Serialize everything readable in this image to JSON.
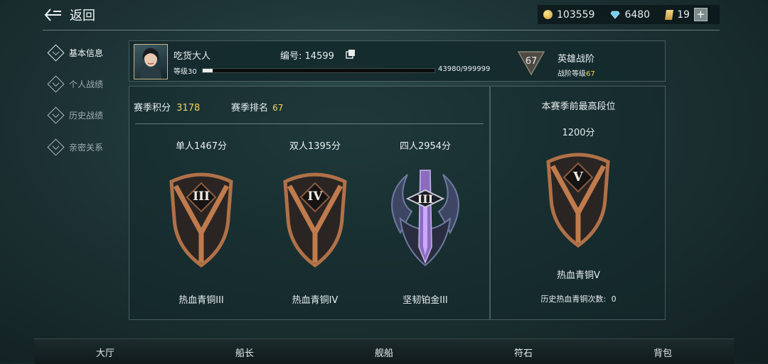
{
  "header": {
    "back_label": "返回"
  },
  "currency": {
    "gold": "103559",
    "diamond": "6480",
    "ticket": "19"
  },
  "sidebar": {
    "items": [
      {
        "label": "基本信息",
        "active": true
      },
      {
        "label": "个人战绩",
        "active": false
      },
      {
        "label": "历史战绩",
        "active": false
      },
      {
        "label": "亲密关系",
        "active": false
      }
    ]
  },
  "profile": {
    "name": "吃货大人",
    "level_label": "等级30",
    "xp_text": "43980/999999",
    "xp_fraction": 0.044,
    "id_label": "编号:",
    "id_value": "14599",
    "rank_badge_value": "67",
    "rank_title": "英雄战阶",
    "rank_sub_label": "战阶等级",
    "rank_sub_value": "67"
  },
  "season": {
    "points_label": "赛季积分",
    "points_value": "3178",
    "rank_label": "赛季排名",
    "rank_value": "67"
  },
  "modes": [
    {
      "score": "单人1467分",
      "numeral": "III",
      "tier": "热血青铜III",
      "badge": "bronze-shield"
    },
    {
      "score": "双人1395分",
      "numeral": "IV",
      "tier": "热血青铜IV",
      "badge": "bronze-shield"
    },
    {
      "score": "四人2954分",
      "numeral": "III",
      "tier": "坚韧铂金III",
      "badge": "platinum-sword"
    }
  ],
  "best": {
    "title": "本赛季前最高段位",
    "score": "1200分",
    "numeral": "V",
    "tier": "热血青铜V",
    "history_label": "历史热血青铜次数:",
    "history_value": "0"
  },
  "bottom_nav": [
    "大厅",
    "船长",
    "舰船",
    "符石",
    "背包"
  ],
  "colors": {
    "accent_yellow": "#f1d65b",
    "bronze": "#b07148",
    "panel_border": "#7f9696"
  }
}
